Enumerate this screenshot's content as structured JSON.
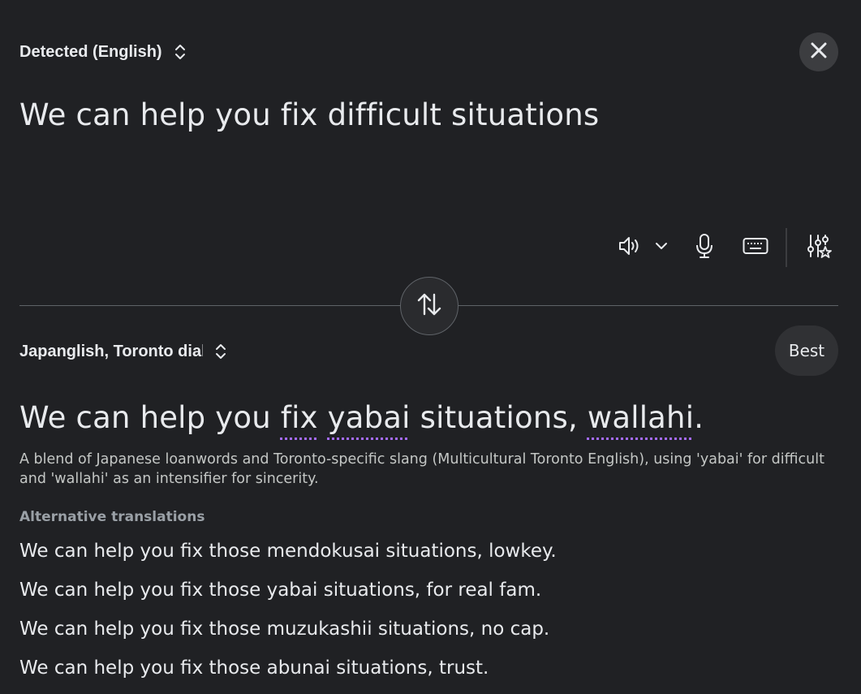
{
  "source": {
    "language_label": "Detected (English)",
    "text": "We can help you fix difficult situations"
  },
  "target": {
    "language_label": "Japanglish, Toronto dialect",
    "quality_label": "Best",
    "translation": {
      "part1": "We can help you ",
      "slang1": "fix",
      "space1": " ",
      "slang2": "yabai",
      "part2": " situations, ",
      "slang3": "wallahi",
      "part3": "."
    },
    "explanation": "A blend of Japanese loanwords and Toronto-specific slang (Multicultural Toronto English), using 'yabai' for difficult and 'wallahi' as an intensifier for sincerity.",
    "alternatives_heading": "Alternative translations",
    "alternatives": [
      "We can help you fix those mendokusai situations, lowkey.",
      "We can help you fix those yabai situations, for real fam.",
      "We can help you fix those muzukashii situations, no cap.",
      "We can help you fix those abunai situations, trust."
    ]
  },
  "icons": {
    "close": "close-icon",
    "speaker": "speaker-icon",
    "chevron": "chevron-down-icon",
    "mic": "microphone-icon",
    "keyboard": "keyboard-icon",
    "settings": "tune-star-icon",
    "swap": "swap-vertical-icon",
    "updown": "unfold-icon"
  },
  "colors": {
    "background": "#202124",
    "text": "#e8eaed",
    "slang_underline": "#a56bff"
  }
}
